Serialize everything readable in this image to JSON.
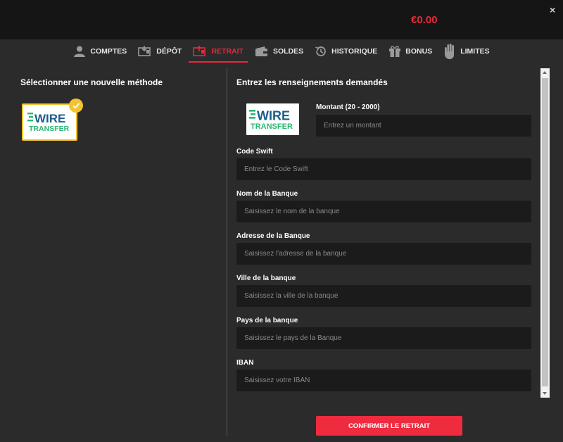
{
  "header": {
    "balance": "€0.00",
    "close_symbol": "×"
  },
  "nav": {
    "items": [
      {
        "label": "COMPTES",
        "icon": "user-icon"
      },
      {
        "label": "DÉPÔT",
        "icon": "deposit-icon"
      },
      {
        "label": "RETRAIT",
        "icon": "withdraw-icon",
        "active": true
      },
      {
        "label": "SOLDES",
        "icon": "wallet-icon"
      },
      {
        "label": "HISTORIQUE",
        "icon": "history-icon"
      },
      {
        "label": "BONUS",
        "icon": "gift-icon"
      },
      {
        "label": "LIMITES",
        "icon": "hand-icon"
      }
    ]
  },
  "left_panel": {
    "title": "Sélectionner une nouvelle méthode",
    "method": {
      "line1": "WIRE",
      "line2": "TRANSFER",
      "selected": true
    }
  },
  "right_panel": {
    "title": "Entrez les renseignements demandés",
    "logo": {
      "line1": "WIRE",
      "line2": "TRANSFER"
    },
    "fields": {
      "amount": {
        "label": "Montant (20 - 2000)",
        "placeholder": "Entrez un montant"
      },
      "swift": {
        "label": "Code Swift",
        "placeholder": "Entrez le Code Swift"
      },
      "bank_name": {
        "label": "Nom de la Banque",
        "placeholder": "Saisissez le nom de la banque"
      },
      "bank_address": {
        "label": "Adresse de la Banque",
        "placeholder": "Saisissez l'adresse de la banque"
      },
      "bank_city": {
        "label": "Ville de la banque",
        "placeholder": "Saisissez la ville de la banque"
      },
      "bank_country": {
        "label": "Pays de la banque",
        "placeholder": "Saisissez le pays de la Banque"
      },
      "iban": {
        "label": "IBAN",
        "placeholder": "Saisissez votre IBAN"
      }
    },
    "confirm_label": "CONFIRMER LE RETRAIT"
  },
  "colors": {
    "accent": "#e8283b",
    "badge": "#f4c430",
    "logo_green": "#2bb673",
    "logo_blue": "#1c5c8c"
  }
}
